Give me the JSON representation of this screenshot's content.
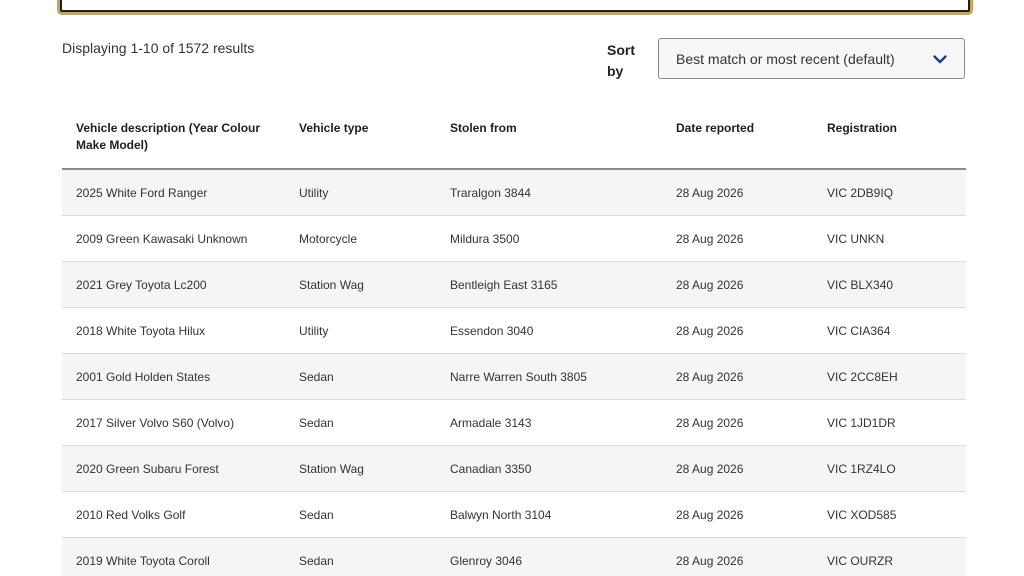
{
  "results": {
    "summary": "Displaying 1-10 of 1572 results"
  },
  "sort": {
    "label": "Sort by",
    "selected": "Best match or most recent (default)"
  },
  "table": {
    "headers": [
      "Vehicle description (Year Colour Make Model)",
      "Vehicle type",
      "Stolen from",
      "Date reported",
      "Registration"
    ],
    "rows": [
      [
        "2025 White Ford Ranger",
        "Utility",
        "Traralgon 3844",
        "28 Aug 2026",
        "VIC 2DB9IQ"
      ],
      [
        "2009 Green Kawasaki Unknown",
        "Motorcycle",
        "Mildura 3500",
        "28 Aug 2026",
        "VIC UNKN"
      ],
      [
        "2021 Grey Toyota Lc200",
        "Station Wag",
        "Bentleigh East 3165",
        "28 Aug 2026",
        "VIC BLX340"
      ],
      [
        "2018 White Toyota Hilux",
        "Utility",
        "Essendon 3040",
        "28 Aug 2026",
        "VIC CIA364"
      ],
      [
        "2001 Gold Holden States",
        "Sedan",
        "Narre Warren South 3805",
        "28 Aug 2026",
        "VIC 2CC8EH"
      ],
      [
        "2017 Silver Volvo S60 (Volvo)",
        "Sedan",
        "Armadale 3143",
        "28 Aug 2026",
        "VIC 1JD1DR"
      ],
      [
        "2020 Green Subaru Forest",
        "Station Wag",
        "Canadian 3350",
        "28 Aug 2026",
        "VIC 1RZ4LO"
      ],
      [
        "2010 Red Volks Golf",
        "Sedan",
        "Balwyn North 3104",
        "28 Aug 2026",
        "VIC XOD585"
      ],
      [
        "2019 White Toyota Coroll",
        "Sedan",
        "Glenroy 3046",
        "28 Aug 2026",
        "VIC OURZR"
      ]
    ]
  },
  "colors": {
    "focus_ring": "#c9a25c",
    "accent": "#1a3c8c"
  },
  "icons": {
    "sort_dropdown": "chevron-down-icon"
  }
}
